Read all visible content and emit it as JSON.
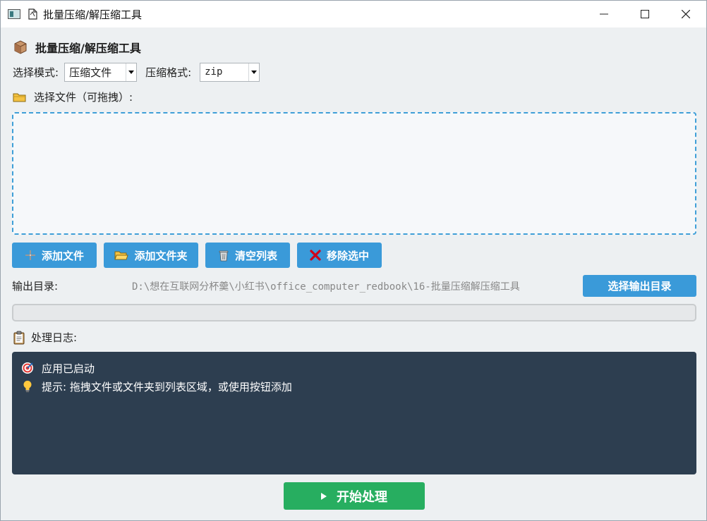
{
  "window": {
    "title": "批量压缩/解压缩工具",
    "controls": {
      "minimize": "—",
      "maximize": "☐",
      "close": "✕"
    }
  },
  "header": {
    "title": "批量压缩/解压缩工具",
    "icon": "package-icon"
  },
  "mode": {
    "label": "选择模式:",
    "value": "压缩文件",
    "format_label": "压缩格式:",
    "format_value": "zip"
  },
  "files": {
    "label": "选择文件（可拖拽）:",
    "icon": "folder-icon",
    "items": []
  },
  "buttons": {
    "add_file": "添加文件",
    "add_folder": "添加文件夹",
    "clear_list": "清空列表",
    "remove_selected": "移除选中"
  },
  "output": {
    "label": "输出目录:",
    "path": "D:\\想在互联网分杯羹\\小红书\\office_computer_redbook\\16-批量压缩解压缩工具",
    "choose_button": "选择输出目录"
  },
  "progress": {
    "value": 0
  },
  "log": {
    "label": "处理日志:",
    "icon": "clipboard-icon",
    "lines": [
      {
        "icon": "target-icon",
        "text": "应用已启动"
      },
      {
        "icon": "lightbulb-icon",
        "text": "提示: 拖拽文件或文件夹到列表区域，或使用按钮添加"
      }
    ]
  },
  "start_button": "开始处理",
  "colors": {
    "accent": "#3a9ad9",
    "start": "#27ae60",
    "log_bg": "#2d3e50",
    "dropzone_border": "#3f9fd8"
  }
}
